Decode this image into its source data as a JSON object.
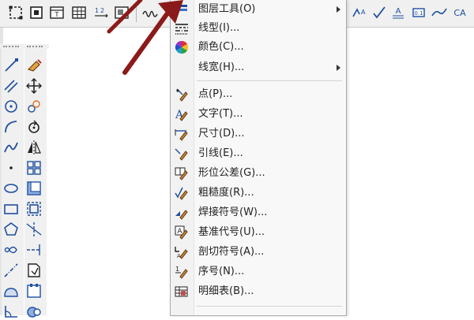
{
  "menu": {
    "items": [
      {
        "label": "图层工具(O)",
        "icon": "layer-tools-icon",
        "submenu": true
      },
      {
        "label": "线型(I)...",
        "icon": "linetype-icon",
        "submenu": false
      },
      {
        "label": "颜色(C)...",
        "icon": "color-wheel-icon",
        "submenu": false
      },
      {
        "label": "线宽(H)...",
        "icon": "lineweight-icon",
        "submenu": true
      },
      {
        "label": "点(P)...",
        "icon": "point-icon",
        "submenu": false
      },
      {
        "label": "文字(T)...",
        "icon": "text-icon",
        "submenu": false
      },
      {
        "label": "尺寸(D)...",
        "icon": "dimension-icon",
        "submenu": false
      },
      {
        "label": "引线(E)...",
        "icon": "leader-icon",
        "submenu": false
      },
      {
        "label": "形位公差(G)...",
        "icon": "geometric-tolerance-icon",
        "submenu": false
      },
      {
        "label": "粗糙度(R)...",
        "icon": "roughness-icon",
        "submenu": false
      },
      {
        "label": "焊接符号(W)...",
        "icon": "weld-symbol-icon",
        "submenu": false
      },
      {
        "label": "基准代号(U)...",
        "icon": "datum-icon",
        "submenu": false
      },
      {
        "label": "剖切符号(A)...",
        "icon": "section-symbol-icon",
        "submenu": false
      },
      {
        "label": "序号(N)...",
        "icon": "sequence-number-icon",
        "submenu": false
      },
      {
        "label": "明细表(B)...",
        "icon": "bill-of-materials-icon",
        "submenu": false
      }
    ]
  },
  "toolbar": {
    "left_icons": [
      "zoom-window-icon",
      "zoom-extents-icon",
      "table-text-icon",
      "table-icon",
      "numbering-icon",
      "image-icon",
      "curve-icon"
    ],
    "right_icons": [
      "text-curve-icon",
      "check-icon",
      "text-annotation-icon",
      "dimension-box-icon",
      "leader-curve-icon",
      "text-style-icon"
    ]
  },
  "left_panel": {
    "col1_icons": [
      "line-icon",
      "parallel-line-icon",
      "circle-icon",
      "arc-icon",
      "spline-icon",
      "point-tool-icon",
      "ellipse-icon",
      "rectangle-icon",
      "polygon-icon",
      "node-icon",
      "centerline-icon",
      "hatch-icon",
      "angle-icon"
    ],
    "col2_icons": [
      "erase-icon",
      "move-icon",
      "copy-icon",
      "rotate-icon",
      "mirror-icon",
      "array-icon",
      "offset-icon",
      "scale-icon",
      "trim-icon",
      "extend-icon",
      "break-icon",
      "chamfer-icon",
      "stretch-icon"
    ]
  },
  "colors": {
    "menu_bg": "#f8f8f8",
    "toolbar_bg": "#f0f0f0",
    "arrow": "#8b1a1a",
    "icon_blue": "#1f4fa0"
  }
}
